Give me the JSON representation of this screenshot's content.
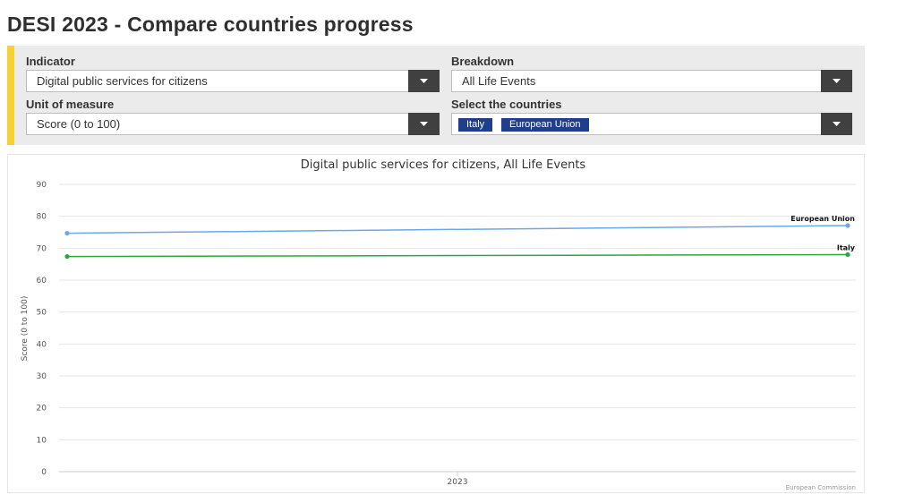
{
  "page": {
    "title": "DESI 2023 - Compare countries progress"
  },
  "controls": {
    "indicator_label": "Indicator",
    "indicator_value": "Digital public services for citizens",
    "breakdown_label": "Breakdown",
    "breakdown_value": "All Life Events",
    "unit_label": "Unit of measure",
    "unit_value": "Score (0 to 100)",
    "countries_label": "Select the countries",
    "selected_countries": [
      "Italy",
      "European Union"
    ],
    "accent_color": "#f5d132",
    "tag_color": "#1f3f8c",
    "dropdown_icon": "chevron-down-icon"
  },
  "chart_data": {
    "type": "line",
    "title": "Digital public services for citizens, All Life Events",
    "xlabel": "",
    "ylabel": "Score (0 to 100)",
    "x_ticks": [
      "2023"
    ],
    "y_ticks": [
      0,
      10,
      20,
      30,
      40,
      50,
      60,
      70,
      80,
      90
    ],
    "ylim": [
      0,
      90
    ],
    "grid": true,
    "legend": "inline labels at line ends",
    "credit": "European Commission",
    "series": [
      {
        "name": "European Union",
        "color": "#6aa8ea",
        "start": 74.7,
        "end": 77.1
      },
      {
        "name": "Italy",
        "color": "#2aa83c",
        "start": 67.4,
        "end": 68.0
      }
    ]
  }
}
